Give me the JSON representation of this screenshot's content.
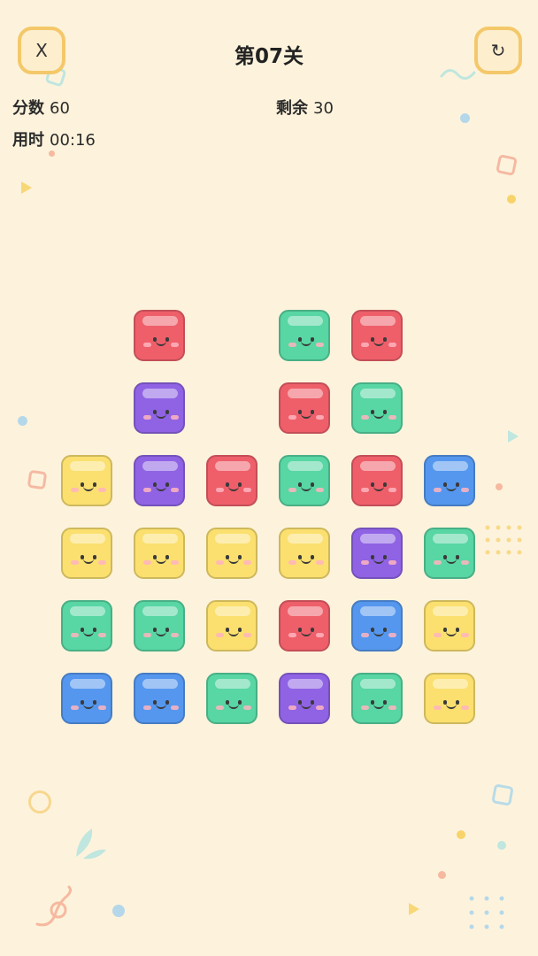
{
  "header": {
    "close_label": "X",
    "level_title": "第07关",
    "reset_label": "↻"
  },
  "stats": {
    "score_label": "分数",
    "score_value": "60",
    "remaining_label": "剩余",
    "remaining_value": "30",
    "time_label": "用时",
    "time_value": "00:16"
  },
  "colors": {
    "red": "#ee5f6a",
    "green": "#58d6a4",
    "purple": "#8f63e4",
    "yellow": "#fbe070",
    "blue": "#5597ee"
  },
  "board": {
    "rows": [
      [
        null,
        "red",
        null,
        "green",
        "red",
        null
      ],
      [
        null,
        "purple",
        null,
        "red",
        "green",
        null
      ],
      [
        "yellow",
        "purple",
        "red",
        "green",
        "red",
        "blue"
      ],
      [
        "yellow",
        "yellow",
        "yellow",
        "yellow",
        "purple",
        "green"
      ],
      [
        "green",
        "green",
        "yellow",
        "red",
        "blue",
        "yellow"
      ],
      [
        "blue",
        "blue",
        "green",
        "purple",
        "green",
        "yellow"
      ]
    ]
  }
}
